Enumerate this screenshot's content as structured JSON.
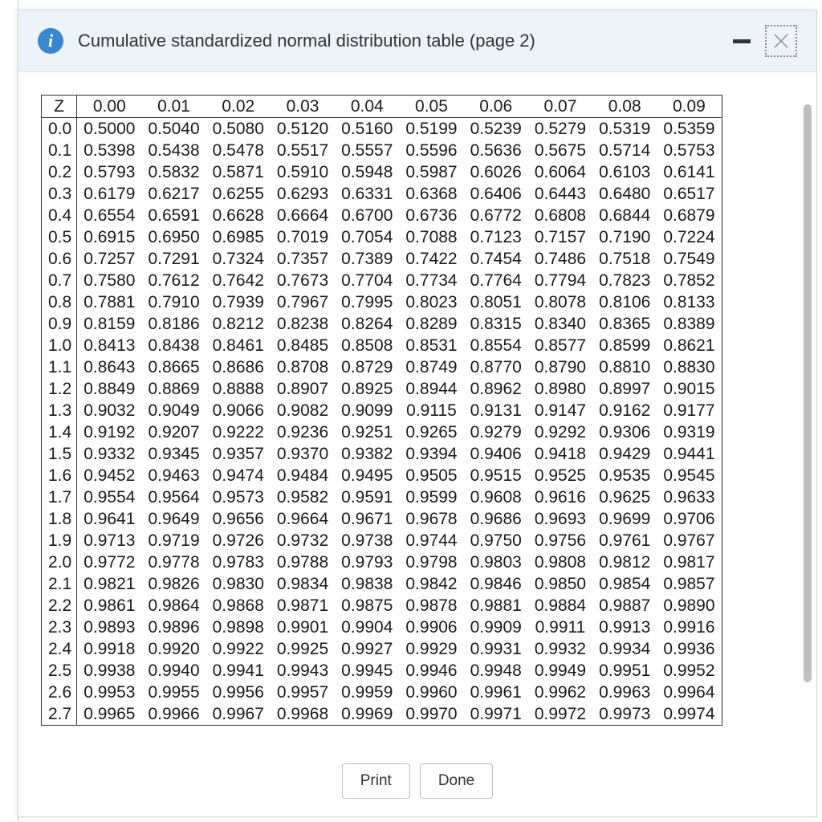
{
  "header": {
    "title": "Cumulative standardized normal distribution table (page 2)",
    "info_glyph": "i"
  },
  "buttons": {
    "print": "Print",
    "done": "Done"
  },
  "table": {
    "corner": "Z",
    "col_headers": [
      "0.00",
      "0.01",
      "0.02",
      "0.03",
      "0.04",
      "0.05",
      "0.06",
      "0.07",
      "0.08",
      "0.09"
    ],
    "rows": [
      {
        "z": "0.0",
        "v": [
          "0.5000",
          "0.5040",
          "0.5080",
          "0.5120",
          "0.5160",
          "0.5199",
          "0.5239",
          "0.5279",
          "0.5319",
          "0.5359"
        ]
      },
      {
        "z": "0.1",
        "v": [
          "0.5398",
          "0.5438",
          "0.5478",
          "0.5517",
          "0.5557",
          "0.5596",
          "0.5636",
          "0.5675",
          "0.5714",
          "0.5753"
        ]
      },
      {
        "z": "0.2",
        "v": [
          "0.5793",
          "0.5832",
          "0.5871",
          "0.5910",
          "0.5948",
          "0.5987",
          "0.6026",
          "0.6064",
          "0.6103",
          "0.6141"
        ]
      },
      {
        "z": "0.3",
        "v": [
          "0.6179",
          "0.6217",
          "0.6255",
          "0.6293",
          "0.6331",
          "0.6368",
          "0.6406",
          "0.6443",
          "0.6480",
          "0.6517"
        ]
      },
      {
        "z": "0.4",
        "v": [
          "0.6554",
          "0.6591",
          "0.6628",
          "0.6664",
          "0.6700",
          "0.6736",
          "0.6772",
          "0.6808",
          "0.6844",
          "0.6879"
        ]
      },
      {
        "z": "0.5",
        "v": [
          "0.6915",
          "0.6950",
          "0.6985",
          "0.7019",
          "0.7054",
          "0.7088",
          "0.7123",
          "0.7157",
          "0.7190",
          "0.7224"
        ]
      },
      {
        "z": "0.6",
        "v": [
          "0.7257",
          "0.7291",
          "0.7324",
          "0.7357",
          "0.7389",
          "0.7422",
          "0.7454",
          "0.7486",
          "0.7518",
          "0.7549"
        ]
      },
      {
        "z": "0.7",
        "v": [
          "0.7580",
          "0.7612",
          "0.7642",
          "0.7673",
          "0.7704",
          "0.7734",
          "0.7764",
          "0.7794",
          "0.7823",
          "0.7852"
        ]
      },
      {
        "z": "0.8",
        "v": [
          "0.7881",
          "0.7910",
          "0.7939",
          "0.7967",
          "0.7995",
          "0.8023",
          "0.8051",
          "0.8078",
          "0.8106",
          "0.8133"
        ]
      },
      {
        "z": "0.9",
        "v": [
          "0.8159",
          "0.8186",
          "0.8212",
          "0.8238",
          "0.8264",
          "0.8289",
          "0.8315",
          "0.8340",
          "0.8365",
          "0.8389"
        ]
      },
      {
        "z": "1.0",
        "v": [
          "0.8413",
          "0.8438",
          "0.8461",
          "0.8485",
          "0.8508",
          "0.8531",
          "0.8554",
          "0.8577",
          "0.8599",
          "0.8621"
        ]
      },
      {
        "z": "1.1",
        "v": [
          "0.8643",
          "0.8665",
          "0.8686",
          "0.8708",
          "0.8729",
          "0.8749",
          "0.8770",
          "0.8790",
          "0.8810",
          "0.8830"
        ]
      },
      {
        "z": "1.2",
        "v": [
          "0.8849",
          "0.8869",
          "0.8888",
          "0.8907",
          "0.8925",
          "0.8944",
          "0.8962",
          "0.8980",
          "0.8997",
          "0.9015"
        ]
      },
      {
        "z": "1.3",
        "v": [
          "0.9032",
          "0.9049",
          "0.9066",
          "0.9082",
          "0.9099",
          "0.9115",
          "0.9131",
          "0.9147",
          "0.9162",
          "0.9177"
        ]
      },
      {
        "z": "1.4",
        "v": [
          "0.9192",
          "0.9207",
          "0.9222",
          "0.9236",
          "0.9251",
          "0.9265",
          "0.9279",
          "0.9292",
          "0.9306",
          "0.9319"
        ]
      },
      {
        "z": "1.5",
        "v": [
          "0.9332",
          "0.9345",
          "0.9357",
          "0.9370",
          "0.9382",
          "0.9394",
          "0.9406",
          "0.9418",
          "0.9429",
          "0.9441"
        ]
      },
      {
        "z": "1.6",
        "v": [
          "0.9452",
          "0.9463",
          "0.9474",
          "0.9484",
          "0.9495",
          "0.9505",
          "0.9515",
          "0.9525",
          "0.9535",
          "0.9545"
        ]
      },
      {
        "z": "1.7",
        "v": [
          "0.9554",
          "0.9564",
          "0.9573",
          "0.9582",
          "0.9591",
          "0.9599",
          "0.9608",
          "0.9616",
          "0.9625",
          "0.9633"
        ]
      },
      {
        "z": "1.8",
        "v": [
          "0.9641",
          "0.9649",
          "0.9656",
          "0.9664",
          "0.9671",
          "0.9678",
          "0.9686",
          "0.9693",
          "0.9699",
          "0.9706"
        ]
      },
      {
        "z": "1.9",
        "v": [
          "0.9713",
          "0.9719",
          "0.9726",
          "0.9732",
          "0.9738",
          "0.9744",
          "0.9750",
          "0.9756",
          "0.9761",
          "0.9767"
        ]
      },
      {
        "z": "2.0",
        "v": [
          "0.9772",
          "0.9778",
          "0.9783",
          "0.9788",
          "0.9793",
          "0.9798",
          "0.9803",
          "0.9808",
          "0.9812",
          "0.9817"
        ]
      },
      {
        "z": "2.1",
        "v": [
          "0.9821",
          "0.9826",
          "0.9830",
          "0.9834",
          "0.9838",
          "0.9842",
          "0.9846",
          "0.9850",
          "0.9854",
          "0.9857"
        ]
      },
      {
        "z": "2.2",
        "v": [
          "0.9861",
          "0.9864",
          "0.9868",
          "0.9871",
          "0.9875",
          "0.9878",
          "0.9881",
          "0.9884",
          "0.9887",
          "0.9890"
        ]
      },
      {
        "z": "2.3",
        "v": [
          "0.9893",
          "0.9896",
          "0.9898",
          "0.9901",
          "0.9904",
          "0.9906",
          "0.9909",
          "0.9911",
          "0.9913",
          "0.9916"
        ]
      },
      {
        "z": "2.4",
        "v": [
          "0.9918",
          "0.9920",
          "0.9922",
          "0.9925",
          "0.9927",
          "0.9929",
          "0.9931",
          "0.9932",
          "0.9934",
          "0.9936"
        ]
      },
      {
        "z": "2.5",
        "v": [
          "0.9938",
          "0.9940",
          "0.9941",
          "0.9943",
          "0.9945",
          "0.9946",
          "0.9948",
          "0.9949",
          "0.9951",
          "0.9952"
        ]
      },
      {
        "z": "2.6",
        "v": [
          "0.9953",
          "0.9955",
          "0.9956",
          "0.9957",
          "0.9959",
          "0.9960",
          "0.9961",
          "0.9962",
          "0.9963",
          "0.9964"
        ]
      },
      {
        "z": "2.7",
        "v": [
          "0.9965",
          "0.9966",
          "0.9967",
          "0.9968",
          "0.9969",
          "0.9970",
          "0.9971",
          "0.9972",
          "0.9973",
          "0.9974"
        ]
      }
    ]
  }
}
